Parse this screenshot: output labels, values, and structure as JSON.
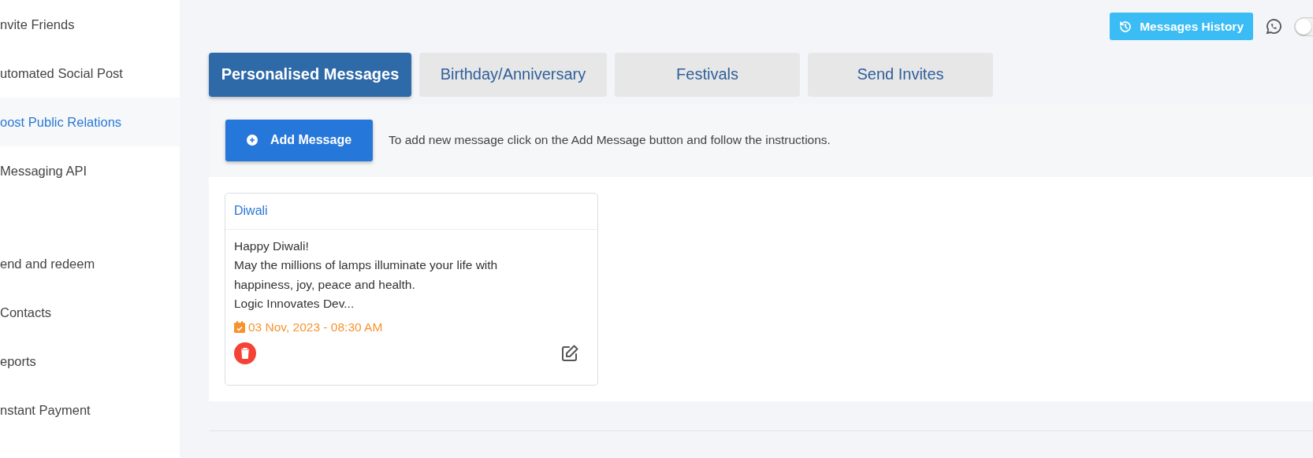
{
  "sidebar": {
    "groups": [
      {
        "items": [
          {
            "label": "nvite Friends",
            "selected": false
          },
          {
            "label": "utomated Social Post",
            "selected": false
          },
          {
            "label": "oost Public Relations",
            "selected": true
          },
          {
            "label": "Messaging API",
            "selected": false
          }
        ]
      },
      {
        "items": [
          {
            "label": "end and redeem",
            "selected": false
          },
          {
            "label": "Contacts",
            "selected": false
          },
          {
            "label": "eports",
            "selected": false
          },
          {
            "label": "nstant Payment",
            "selected": false
          }
        ]
      }
    ]
  },
  "header": {
    "history_button": "Messages History",
    "whatsapp_toggle": {
      "on": false
    }
  },
  "tabs": [
    {
      "label": "Personalised Messages",
      "selected": true
    },
    {
      "label": "Birthday/Anniversary",
      "selected": false
    },
    {
      "label": "Festivals",
      "selected": false
    },
    {
      "label": "Send Invites",
      "selected": false
    }
  ],
  "toolbar": {
    "add_button": "Add Message",
    "hint": "To add new message click on the Add Message button and follow the instructions."
  },
  "messages": [
    {
      "title": "Diwali",
      "lines": [
        "Happy Diwali!",
        "May the millions of lamps illuminate your life with happiness, joy, peace and health.",
        "Logic Innovates Dev..."
      ],
      "date": "03 Nov, 2023 - 08:30 AM"
    }
  ]
}
